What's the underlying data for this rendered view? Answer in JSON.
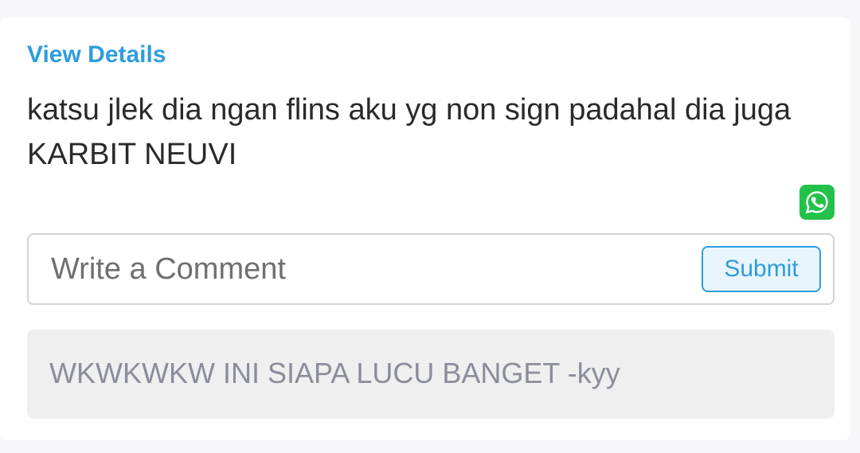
{
  "post": {
    "view_details_label": "View Details",
    "text": "katsu jlek dia ngan flins aku yg non sign padahal dia juga KARBIT NEUVI"
  },
  "share": {
    "icon": "whatsapp-icon",
    "color": "#22c24a"
  },
  "comment_form": {
    "placeholder": "Write a Comment",
    "value": "",
    "submit_label": "Submit"
  },
  "comments": [
    {
      "text": "WKWKWKW INI SIAPA LUCU BANGET -kyy"
    }
  ],
  "colors": {
    "accent": "#2d9ddd",
    "background": "#f7f7fb",
    "card": "#ffffff",
    "comment_bg": "#efefef"
  }
}
